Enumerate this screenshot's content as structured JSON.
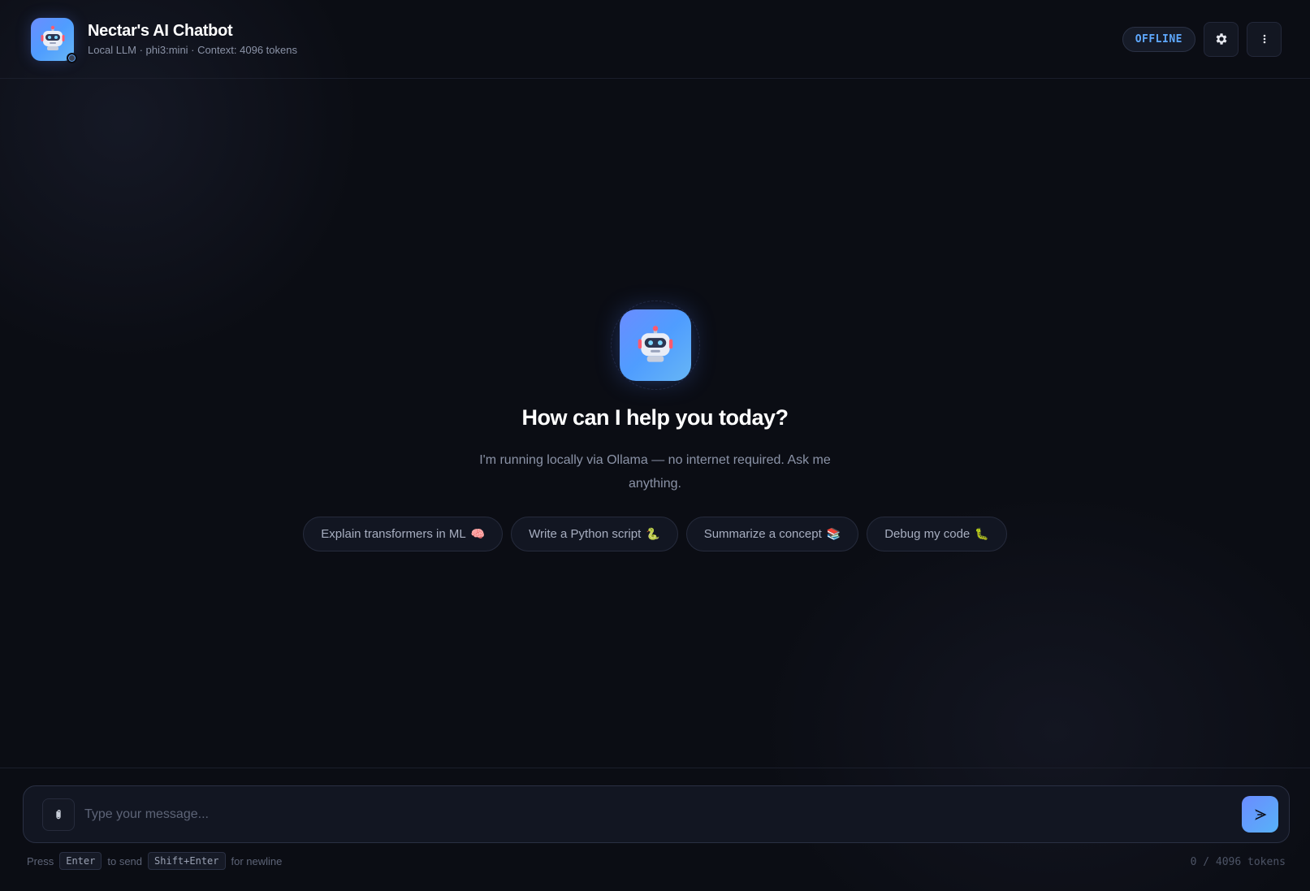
{
  "header": {
    "title": "Nectar's AI Chatbot",
    "subtitle": "Local LLM · phi3:mini · Context: 4096 tokens",
    "status_badge": "OFFLINE",
    "avatar_icon": "robot-icon",
    "settings_icon": "gear-icon",
    "menu_icon": "more-vertical-icon"
  },
  "welcome": {
    "avatar_icon": "robot-icon",
    "title": "How can I help you today?",
    "description": "I'm running locally via Ollama — no internet required. Ask me anything.",
    "suggestions": [
      {
        "label": "Explain transformers in ML",
        "emoji": "🧠"
      },
      {
        "label": "Write a Python script",
        "emoji": "🐍"
      },
      {
        "label": "Summarize a concept",
        "emoji": "📚"
      },
      {
        "label": "Debug my code",
        "emoji": "🐛"
      }
    ]
  },
  "composer": {
    "attach_icon": "paperclip-icon",
    "placeholder": "Type your message...",
    "value": "",
    "send_icon": "send-icon"
  },
  "hint": {
    "press": "Press",
    "enter_key": "Enter",
    "to_send": "to send",
    "shift_enter_key": "Shift+Enter",
    "for_newline": "for newline"
  },
  "token_count": "0 / 4096 tokens",
  "colors": {
    "background": "#0b0d14",
    "accent": "#5fa9ff",
    "brand_gradient_start": "#6b8cff",
    "brand_gradient_end": "#67b6f5"
  }
}
